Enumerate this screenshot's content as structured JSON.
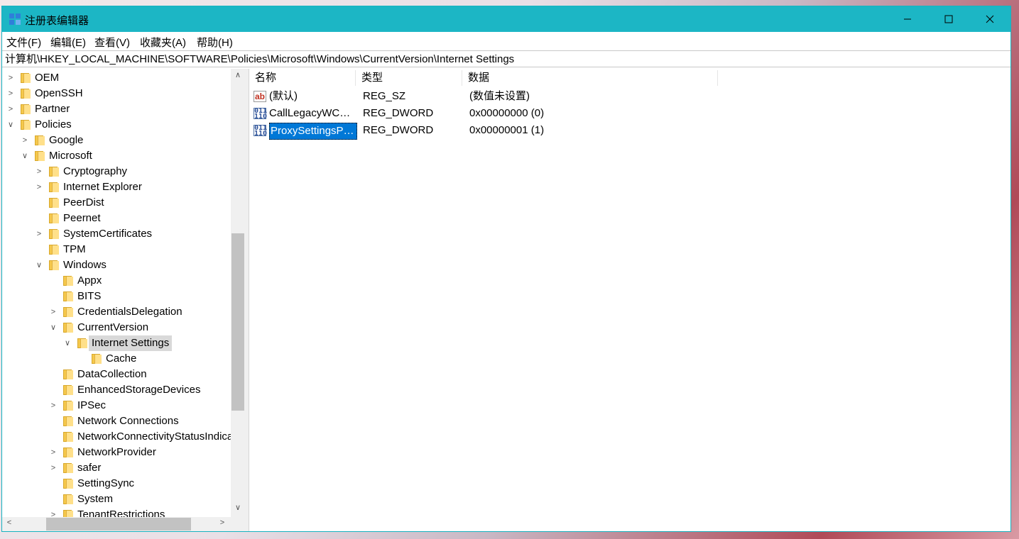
{
  "window": {
    "title": "注册表编辑器"
  },
  "menu": [
    "文件(F)",
    "编辑(E)",
    "查看(V)",
    "收藏夹(A)",
    "帮助(H)"
  ],
  "address": "计算机\\HKEY_LOCAL_MACHINE\\SOFTWARE\\Policies\\Microsoft\\Windows\\CurrentVersion\\Internet Settings",
  "tree": [
    {
      "label": "OEM",
      "depth": 0,
      "state": "collapsed"
    },
    {
      "label": "OpenSSH",
      "depth": 0,
      "state": "collapsed"
    },
    {
      "label": "Partner",
      "depth": 0,
      "state": "collapsed"
    },
    {
      "label": "Policies",
      "depth": 0,
      "state": "expanded"
    },
    {
      "label": "Google",
      "depth": 1,
      "state": "collapsed"
    },
    {
      "label": "Microsoft",
      "depth": 1,
      "state": "expanded"
    },
    {
      "label": "Cryptography",
      "depth": 2,
      "state": "collapsed"
    },
    {
      "label": "Internet Explorer",
      "depth": 2,
      "state": "collapsed"
    },
    {
      "label": "PeerDist",
      "depth": 2,
      "state": "leaf"
    },
    {
      "label": "Peernet",
      "depth": 2,
      "state": "leaf"
    },
    {
      "label": "SystemCertificates",
      "depth": 2,
      "state": "collapsed"
    },
    {
      "label": "TPM",
      "depth": 2,
      "state": "leaf"
    },
    {
      "label": "Windows",
      "depth": 2,
      "state": "expanded"
    },
    {
      "label": "Appx",
      "depth": 3,
      "state": "leaf"
    },
    {
      "label": "BITS",
      "depth": 3,
      "state": "leaf"
    },
    {
      "label": "CredentialsDelegation",
      "depth": 3,
      "state": "collapsed"
    },
    {
      "label": "CurrentVersion",
      "depth": 3,
      "state": "expanded"
    },
    {
      "label": "Internet Settings",
      "depth": 4,
      "state": "expanded",
      "selected": true
    },
    {
      "label": "Cache",
      "depth": 5,
      "state": "leaf"
    },
    {
      "label": "DataCollection",
      "depth": 3,
      "state": "leaf"
    },
    {
      "label": "EnhancedStorageDevices",
      "depth": 3,
      "state": "leaf"
    },
    {
      "label": "IPSec",
      "depth": 3,
      "state": "collapsed"
    },
    {
      "label": "Network Connections",
      "depth": 3,
      "state": "leaf"
    },
    {
      "label": "NetworkConnectivityStatusIndicator",
      "depth": 3,
      "state": "leaf"
    },
    {
      "label": "NetworkProvider",
      "depth": 3,
      "state": "collapsed"
    },
    {
      "label": "safer",
      "depth": 3,
      "state": "collapsed"
    },
    {
      "label": "SettingSync",
      "depth": 3,
      "state": "leaf"
    },
    {
      "label": "System",
      "depth": 3,
      "state": "leaf"
    },
    {
      "label": "TenantRestrictions",
      "depth": 3,
      "state": "collapsed"
    }
  ],
  "list": {
    "columns": [
      "名称",
      "类型",
      "数据"
    ],
    "rows": [
      {
        "icon": "string-value-icon",
        "name": "(默认)",
        "type": "REG_SZ",
        "data": "(数值未设置)"
      },
      {
        "icon": "binary-value-icon",
        "name": "CallLegacyWCMPolicies",
        "type": "REG_DWORD",
        "data": "0x00000000 (0)"
      },
      {
        "icon": "binary-value-icon",
        "name": "ProxySettingsPerUser",
        "type": "REG_DWORD",
        "data": "0x00000001 (1)",
        "selected": true
      }
    ]
  },
  "colors": {
    "titlebar": "#1cb6c5",
    "selection": "#0078d7",
    "tree_selection": "#d9d9d9"
  }
}
